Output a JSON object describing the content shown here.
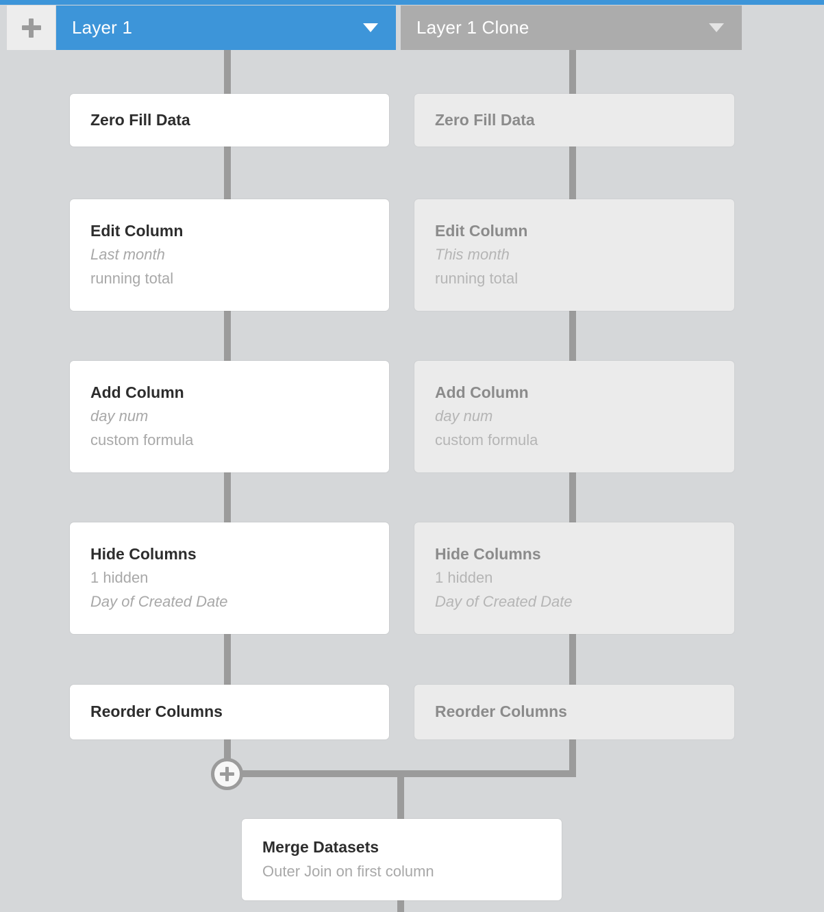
{
  "theme": {
    "canvas_bg": "#d5d7d9",
    "accent_blue": "#3d95d9",
    "inactive_tab_gray": "#acacac",
    "connector_gray": "#9b9b9b",
    "active_card_bg": "#ffffff",
    "inactive_card_bg": "#ebebeb"
  },
  "toolbar": {
    "add_layer_label": "+",
    "add_layer_icon": "plus-icon"
  },
  "tabs": [
    {
      "label": "Layer 1",
      "state": "active",
      "caret_icon": "chevron-down-icon"
    },
    {
      "label": "Layer 1 Clone",
      "state": "inactive",
      "caret_icon": "chevron-down-icon"
    }
  ],
  "pipelines": {
    "left": {
      "layer": "Layer 1",
      "state": "active",
      "steps": [
        {
          "title": "Zero Fill Data",
          "detail1": "",
          "detail1_italic": false,
          "detail2": "",
          "detail2_italic": false
        },
        {
          "title": "Edit Column",
          "detail1": "Last month",
          "detail1_italic": true,
          "detail2": "running total",
          "detail2_italic": false
        },
        {
          "title": "Add Column",
          "detail1": "day num",
          "detail1_italic": true,
          "detail2": "custom formula",
          "detail2_italic": false
        },
        {
          "title": "Hide Columns",
          "detail1": "1 hidden",
          "detail1_italic": false,
          "detail2": "Day of Created Date",
          "detail2_italic": true
        },
        {
          "title": "Reorder Columns",
          "detail1": "",
          "detail1_italic": false,
          "detail2": "",
          "detail2_italic": false
        }
      ]
    },
    "right": {
      "layer": "Layer 1 Clone",
      "state": "inactive",
      "steps": [
        {
          "title": "Zero Fill Data",
          "detail1": "",
          "detail1_italic": false,
          "detail2": "",
          "detail2_italic": false
        },
        {
          "title": "Edit Column",
          "detail1": "This month",
          "detail1_italic": true,
          "detail2": "running total",
          "detail2_italic": false
        },
        {
          "title": "Add Column",
          "detail1": "day num",
          "detail1_italic": true,
          "detail2": "custom formula",
          "detail2_italic": false
        },
        {
          "title": "Hide Columns",
          "detail1": "1 hidden",
          "detail1_italic": false,
          "detail2": "Day of Created Date",
          "detail2_italic": true
        },
        {
          "title": "Reorder Columns",
          "detail1": "",
          "detail1_italic": false,
          "detail2": "",
          "detail2_italic": false
        }
      ]
    }
  },
  "junction": {
    "icon": "plus-in-circle-icon",
    "label": "+"
  },
  "merge_node": {
    "title": "Merge Datasets",
    "detail": "Outer Join on first column"
  }
}
